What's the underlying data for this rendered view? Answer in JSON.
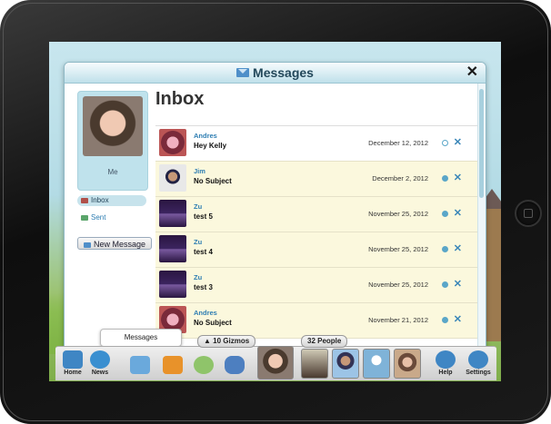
{
  "dialog": {
    "title": "Messages",
    "close_label": "✕"
  },
  "sidebar": {
    "me_label": "Me",
    "items": [
      {
        "label": "Inbox",
        "active": true
      },
      {
        "label": "Sent",
        "active": false
      }
    ],
    "new_message_label": "New Message"
  },
  "main": {
    "heading": "Inbox",
    "messages": [
      {
        "sender": "Andres",
        "subject": "Hey Kelly",
        "date": "December 12, 2012",
        "read": true
      },
      {
        "sender": "Jim",
        "subject": "No Subject",
        "date": "December 2, 2012",
        "read": false
      },
      {
        "sender": "Zu",
        "subject": "test 5",
        "date": "November 25, 2012",
        "read": false
      },
      {
        "sender": "Zu",
        "subject": "test 4",
        "date": "November 25, 2012",
        "read": false
      },
      {
        "sender": "Zu",
        "subject": "test 3",
        "date": "November 25, 2012",
        "read": false
      },
      {
        "sender": "Andres",
        "subject": "No Subject",
        "date": "November 21, 2012",
        "read": false
      }
    ],
    "delete_glyph": "✕"
  },
  "dock": {
    "tooltip": "Messages",
    "home_label": "Home",
    "news_label": "News",
    "gizmos_badge": "▲ 10 Gizmos",
    "people_badge": "32 People",
    "help_label": "Help",
    "settings_label": "Settings"
  },
  "colors": {
    "accent": "#2d7db2",
    "unread_row": "#fbf8dd",
    "titlebar": "#bfe0ea"
  }
}
